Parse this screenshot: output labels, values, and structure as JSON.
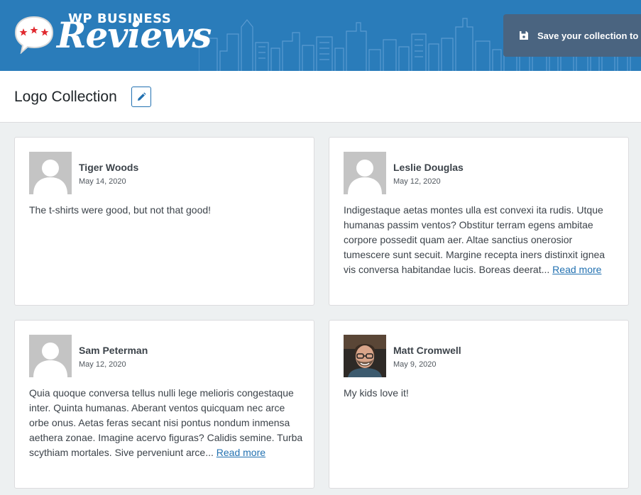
{
  "header": {
    "logo_top": "WP BUSINESS",
    "logo_script": "Reviews",
    "save_label": "Save your collection to u"
  },
  "page": {
    "title": "Logo Collection"
  },
  "colors": {
    "header_bg": "#2a7cba",
    "save_button_bg": "#4a6480",
    "link": "#2271b1",
    "stars": "#e0282e"
  },
  "reviews": [
    {
      "name": "Tiger Woods",
      "date": "May 14, 2020",
      "text": "The t-shirts were good, but not that good!",
      "read_more": "",
      "avatar": "placeholder"
    },
    {
      "name": "Leslie Douglas",
      "date": "May 12, 2020",
      "text": "Indigestaque aetas montes ulla est convexi ita rudis. Utque humanas passim ventos? Obstitur terram egens ambitae corpore possedit quam aer. Altae sanctius onerosior tumescere sunt secuit. Margine recepta iners distinxit ignea vis conversa habitandae lucis. Boreas deerat...",
      "read_more": "Read more",
      "avatar": "placeholder"
    },
    {
      "name": "Sam Peterman",
      "date": "May 12, 2020",
      "text": "Quia quoque conversa tellus nulli lege melioris congestaque inter. Quinta humanas. Aberant ventos quicquam nec arce orbe onus. Aetas feras secant nisi pontus nondum inmensa aethera zonae. Imagine acervo figuras? Calidis semine. Turba scythiam mortales. Sive perveniunt arce...",
      "read_more": "Read more",
      "avatar": "placeholder"
    },
    {
      "name": "Matt Cromwell",
      "date": "May 9, 2020",
      "text": "My kids love it!",
      "read_more": "",
      "avatar": "photo"
    }
  ]
}
